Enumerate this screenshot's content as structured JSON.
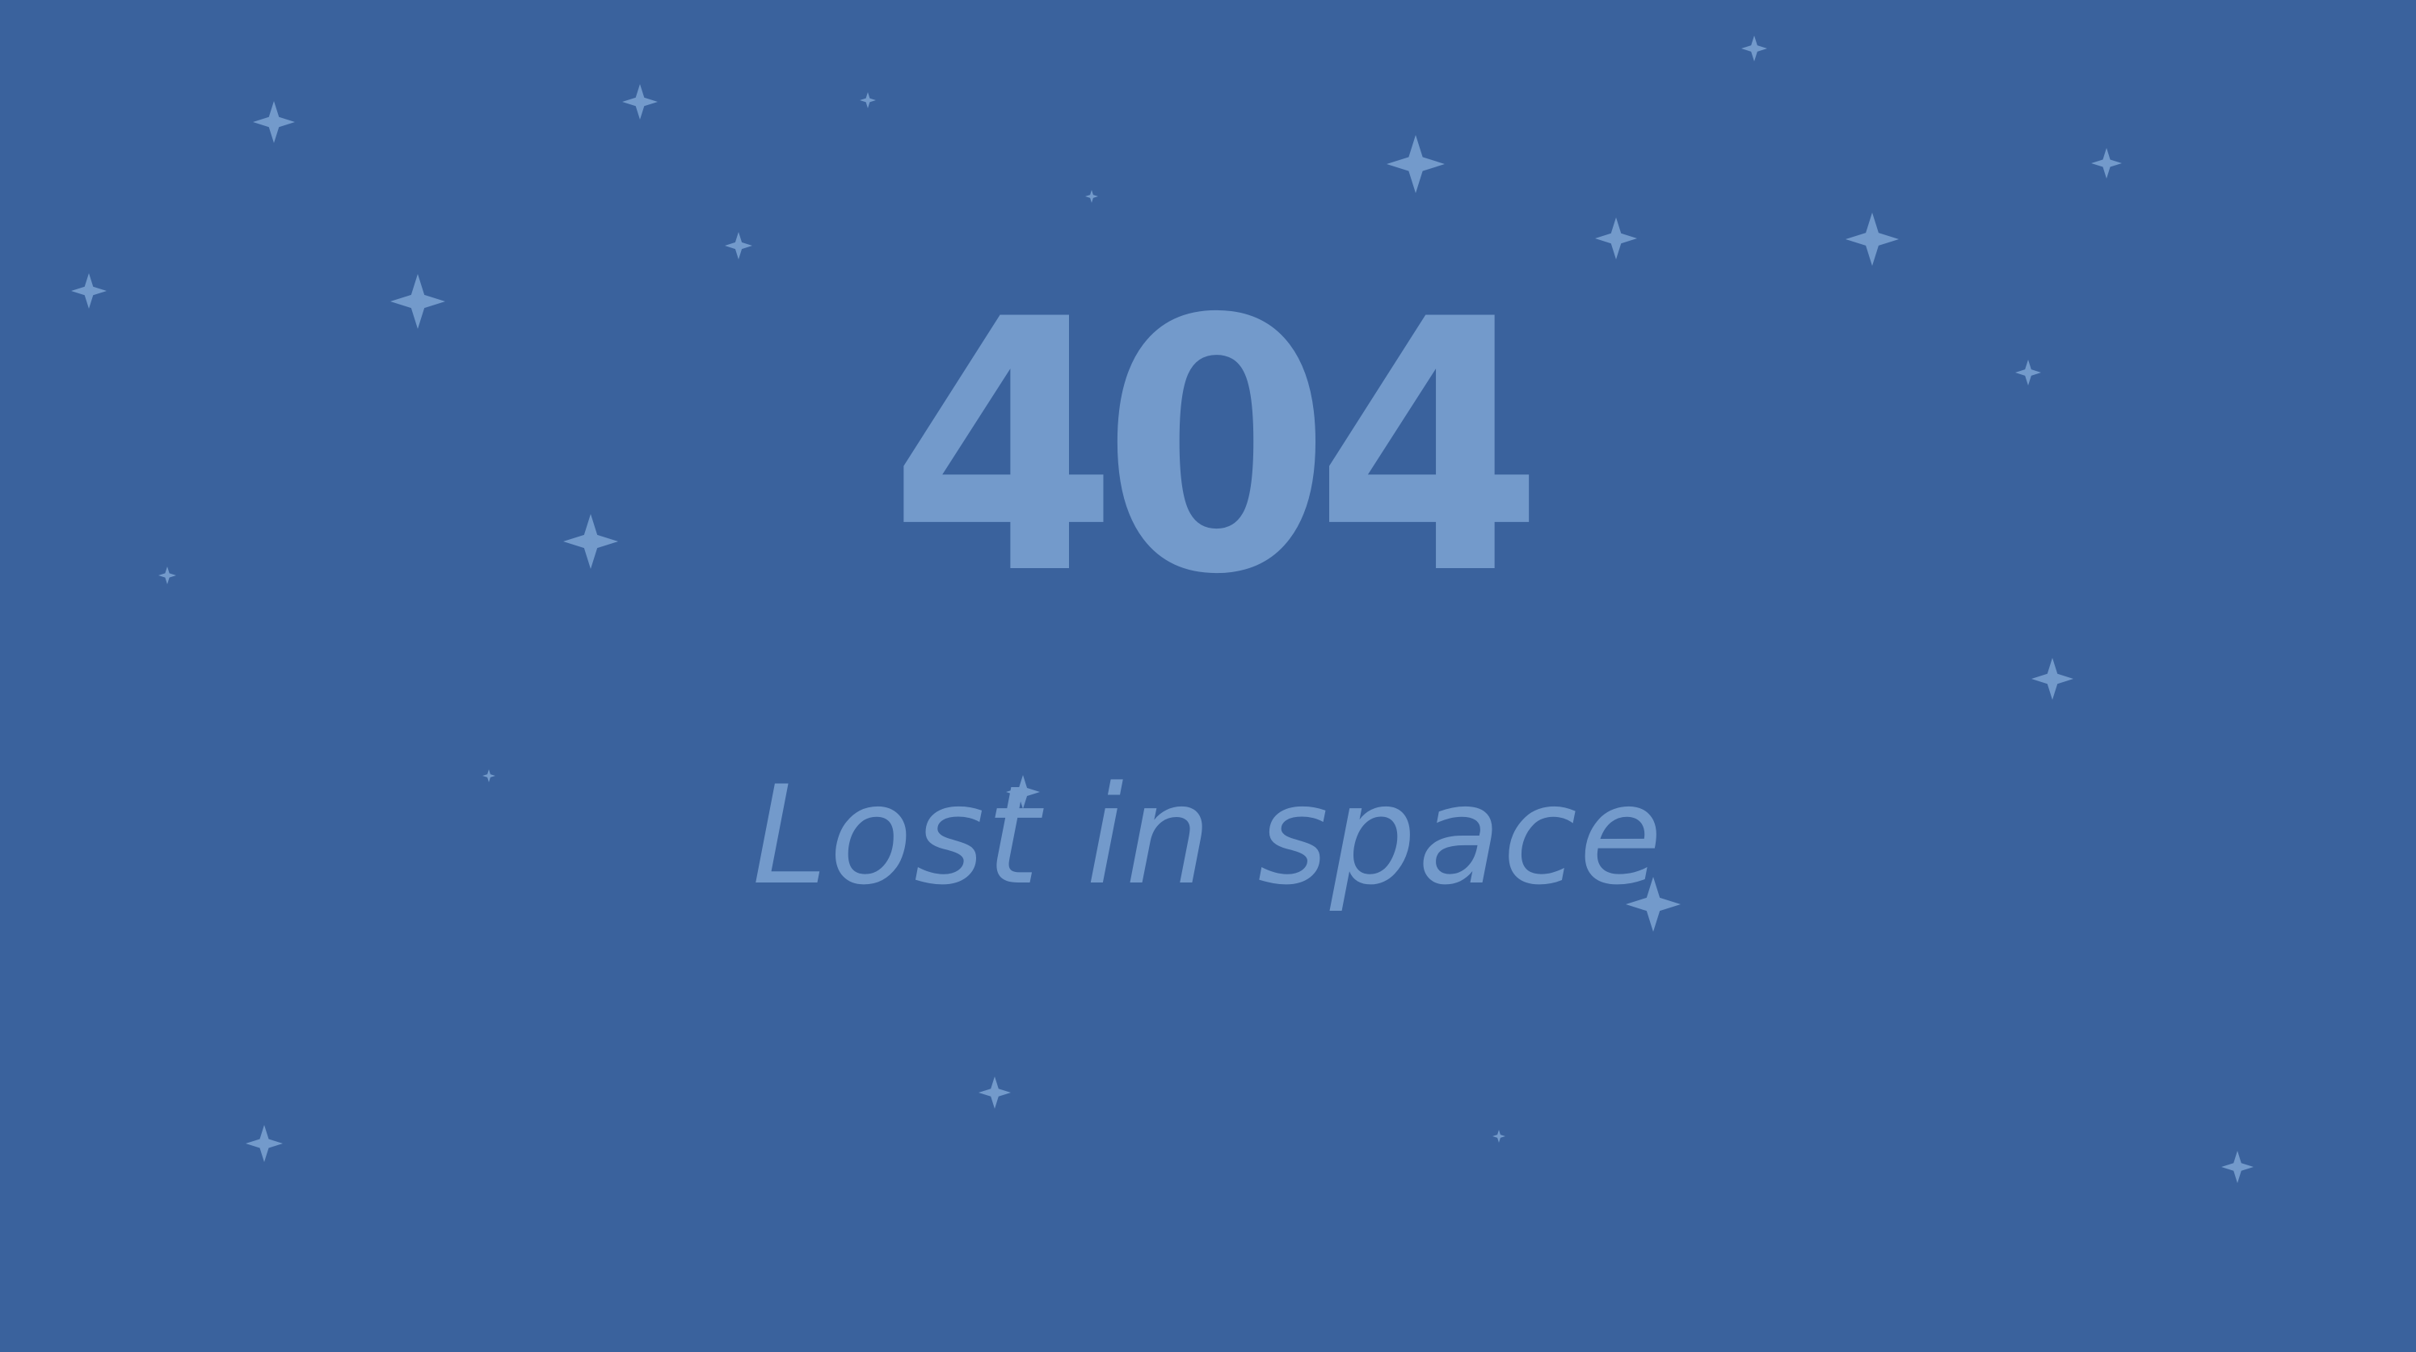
{
  "page": {
    "background_color": "#3a629d",
    "accent_color": "#739acb"
  },
  "error": {
    "code": "404",
    "message": "Lost in space"
  },
  "decoration": {
    "icon": "sparkle-star-icon",
    "star_count": 32
  }
}
